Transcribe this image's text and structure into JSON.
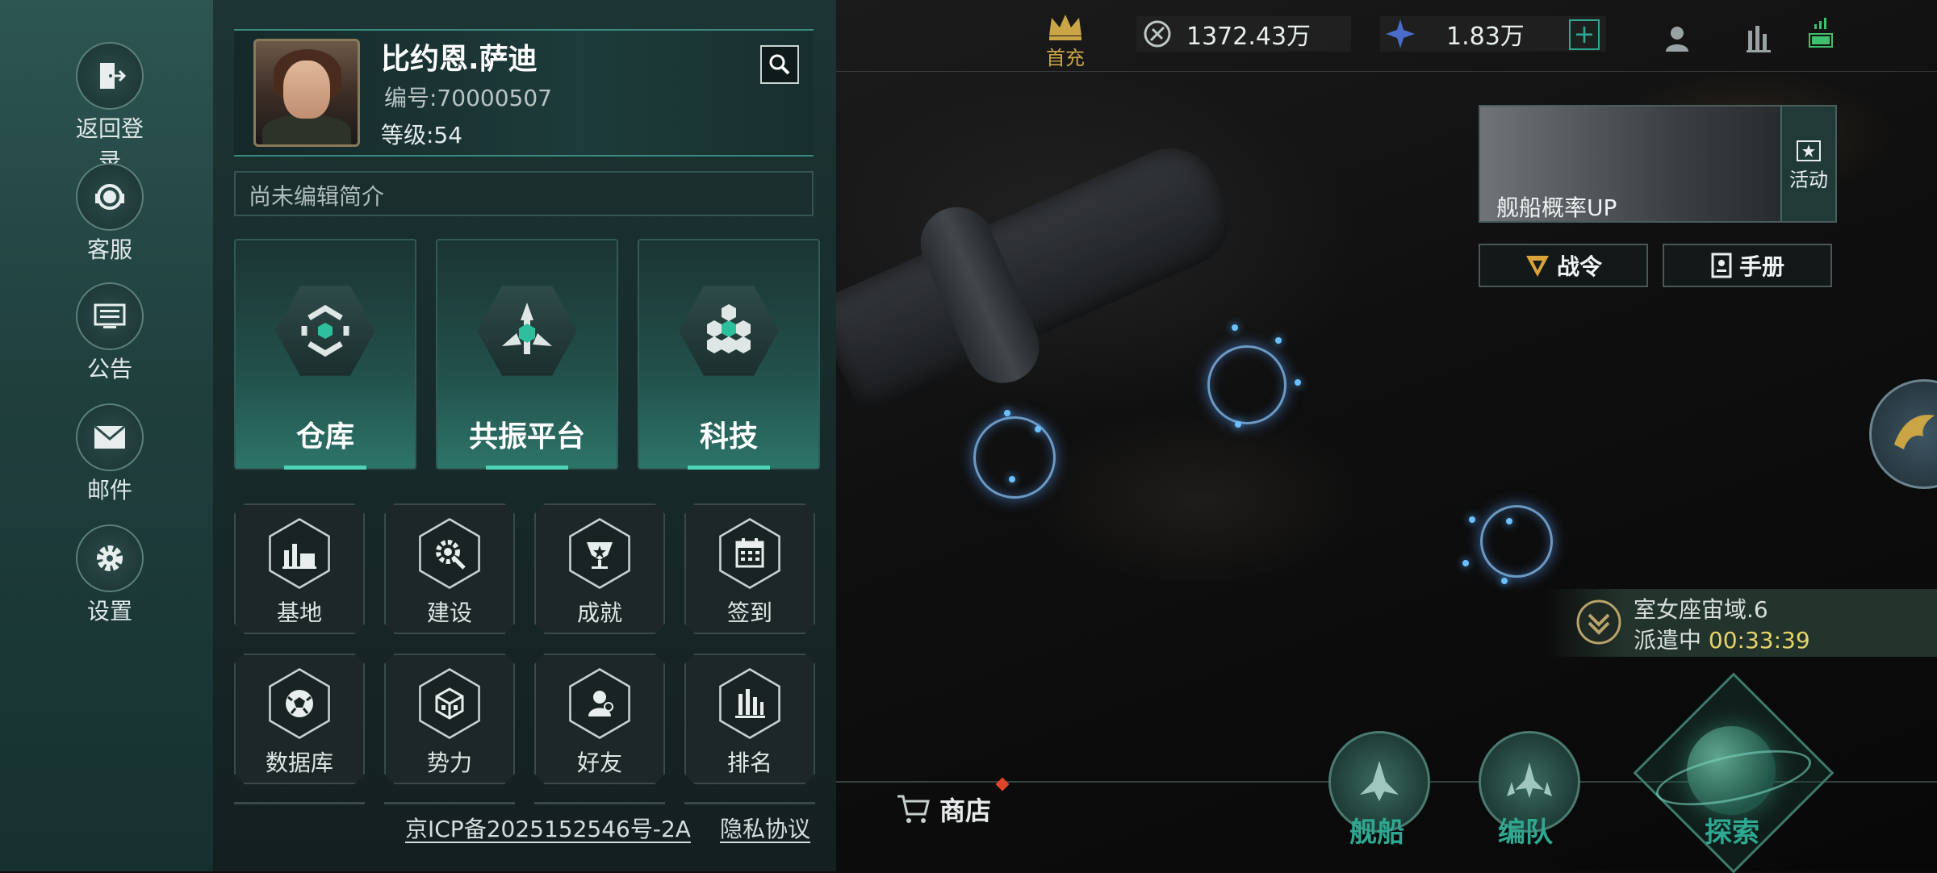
{
  "sidebar": {
    "items": [
      {
        "label": "返回登录",
        "icon": "logout-door-icon"
      },
      {
        "label": "客服",
        "icon": "customer-service-icon"
      },
      {
        "label": "公告",
        "icon": "announcement-icon"
      },
      {
        "label": "邮件",
        "icon": "mail-icon"
      },
      {
        "label": "设置",
        "icon": "gear-icon"
      }
    ]
  },
  "profile": {
    "name": "比约恩.萨迪",
    "id_text": "编号:70000507",
    "level_text": "等级:54",
    "bio_placeholder": "尚未编辑简介"
  },
  "main_cards": [
    {
      "label": "仓库",
      "icon": "warehouse-icon"
    },
    {
      "label": "共振平台",
      "icon": "resonance-icon"
    },
    {
      "label": "科技",
      "icon": "tech-icon"
    }
  ],
  "grid_cards": [
    {
      "label": "基地",
      "icon": "base-factory-icon"
    },
    {
      "label": "建设",
      "icon": "build-gear-icon"
    },
    {
      "label": "成就",
      "icon": "achievement-icon"
    },
    {
      "label": "签到",
      "icon": "calendar-icon"
    },
    {
      "label": "数据库",
      "icon": "database-ball-icon"
    },
    {
      "label": "势力",
      "icon": "faction-box-icon"
    },
    {
      "label": "好友",
      "icon": "friends-icon"
    },
    {
      "label": "排名",
      "icon": "ranking-icon"
    }
  ],
  "footer": {
    "icp": "京ICP备2025152546号-2A",
    "privacy": "隐私协议"
  },
  "hud": {
    "first_charge": "首充",
    "resource1": "1372.43万",
    "resource2": "1.83万",
    "add": "+"
  },
  "event": {
    "banner_text": "舰船概率UP",
    "side_label": "活动"
  },
  "buttons": {
    "battle_pass": "战令",
    "manual": "手册",
    "shop": "商店"
  },
  "dispatch": {
    "location": "室女座宙域.6",
    "status": "派遣中",
    "timer": "00:33:39"
  },
  "nav": {
    "ships": "舰船",
    "fleet": "编队",
    "explore": "探索"
  },
  "colors": {
    "accent_teal": "#2ea890",
    "timer_yellow": "#e6d46a",
    "gold": "#c9a545"
  }
}
